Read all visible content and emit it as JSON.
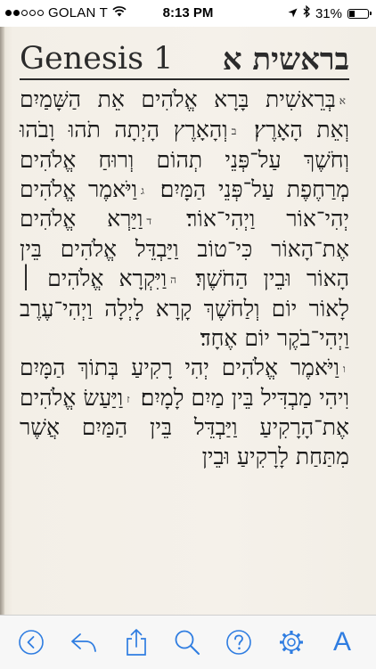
{
  "status_bar": {
    "carrier": "GOLAN T",
    "time": "8:13 PM",
    "battery": "31%",
    "battery_level": 0.31,
    "signal_bars_filled": 2,
    "signal_bars_total": 5
  },
  "chapter": {
    "title_en": "Genesis 1",
    "title_he": "בראשית א"
  },
  "verses": [
    {
      "num": "א",
      "text": "בְּרֵאשִׁית בָּרָא אֱלֹהִים אֵת הַשָּׁמַיִם וְאֵת הָאָרֶץ׃"
    },
    {
      "num": "ב",
      "text": "וְהָאָרֶץ הָיְתָה תֹהוּ וָבֹהוּ וְחֹשֶׁךְ עַל־פְּנֵי תְהוֹם וְרוּחַ אֱלֹהִים מְרַחֶפֶת עַל־פְּנֵי הַמָּיִם׃"
    },
    {
      "num": "ג",
      "text": "וַיֹּאמֶר אֱלֹהִים יְהִי־אוֹר וַיְהִי־אוֹר׃"
    },
    {
      "num": "ד",
      "text": "וַיַּרְא אֱלֹהִים אֶת־הָאוֹר כִּי־טוֹב וַיַּבְדֵּל אֱלֹהִים בֵּין הָאוֹר וּבֵין הַחֹשֶׁךְ׃"
    },
    {
      "num": "ה",
      "text": "וַיִּקְרָא אֱלֹהִים ׀ לָאוֹר יוֹם וְלַחֹשֶׁךְ קָרָא לָיְלָה וַיְהִי־עֶרֶב וַיְהִי־בֹקֶר יוֹם אֶחָד׃",
      "paragraph_end": true
    },
    {
      "num": "ו",
      "text": "וַיֹּאמֶר אֱלֹהִים יְהִי רָקִיעַ בְּתוֹךְ הַמָּיִם וִיהִי מַבְדִּיל בֵּין מַיִם לָמָיִם׃"
    },
    {
      "num": "ז",
      "text": "וַיַּעַשׂ אֱלֹהִים אֶת־הָרָקִיעַ וַיַּבְדֵּל בֵּין הַמַּיִם אֲשֶׁר מִתַּחַת לָרָקִיעַ וּבֵין"
    }
  ],
  "toolbar": {
    "icons": [
      "back-circle-icon",
      "reply-icon",
      "share-icon",
      "search-icon",
      "help-icon",
      "gear-icon",
      "font-icon"
    ],
    "font_label": "A",
    "accent": "#2f7de1"
  }
}
